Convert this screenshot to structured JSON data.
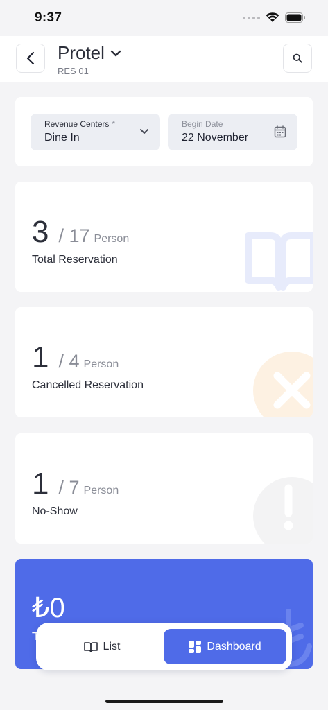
{
  "status_bar": {
    "time": "9:37"
  },
  "header": {
    "title": "Protel",
    "subtitle": "RES 01"
  },
  "filters": {
    "revenue_centers": {
      "label": "Revenue Centers",
      "required_mark": "*",
      "value": "Dine In"
    },
    "begin_date": {
      "label": "Begin Date",
      "value": "22 November"
    }
  },
  "stats": [
    {
      "value": "3",
      "total": "/ 17",
      "unit": "Person",
      "label": "Total Reservation",
      "icon": "book-icon"
    },
    {
      "value": "1",
      "total": "/ 4",
      "unit": "Person",
      "label": "Cancelled Reservation",
      "icon": "cancel-x-icon"
    },
    {
      "value": "1",
      "total": "/ 7",
      "unit": "Person",
      "label": "No-Show",
      "icon": "exclamation-icon"
    }
  ],
  "revenue": {
    "amount": "₺0",
    "label": "T"
  },
  "tabs": {
    "list": "List",
    "dashboard": "Dashboard",
    "active": "dashboard"
  },
  "colors": {
    "accent": "#4f6be8",
    "background": "#f4f4f6",
    "card": "#ffffff",
    "field": "#eceef3"
  }
}
